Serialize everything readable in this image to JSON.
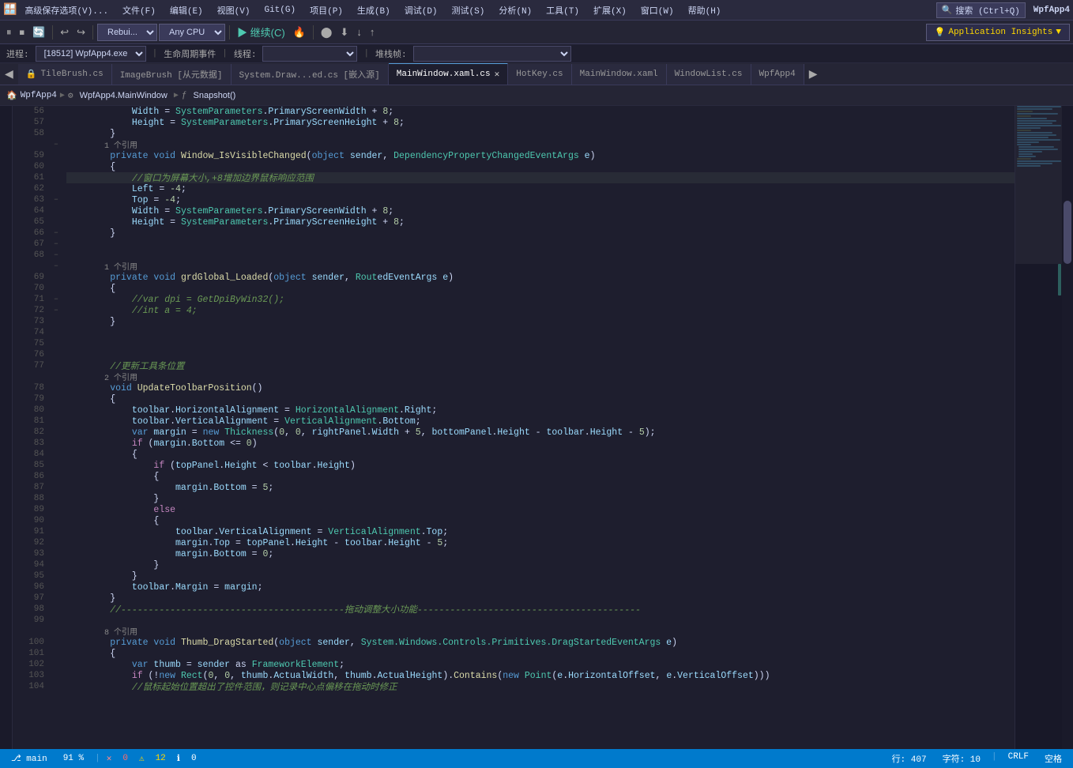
{
  "app": {
    "title": "WpfApp4",
    "window_title": "WpfApp4"
  },
  "menubar": {
    "items": [
      "高级保存选项(V)...",
      "文件(F)",
      "编辑(E)",
      "视图(V)",
      "Git(G)",
      "项目(P)",
      "生成(B)",
      "调试(D)",
      "测试(S)",
      "分析(N)",
      "工具(T)",
      "扩展(X)",
      "窗口(W)",
      "帮助(H)"
    ],
    "search_placeholder": "搜索 (Ctrl+Q)",
    "app_name": "WpfApp4"
  },
  "toolbar": {
    "debug_label": "Rebui...",
    "cpu_label": "Any CPU",
    "insights_label": "Application Insights"
  },
  "process_bar": {
    "process_label": "进程:",
    "process_value": "[18512] WpfApp4.exe",
    "lifecycle_label": "生命周期事件",
    "thread_label": "线程:",
    "stack_label": "堆栈帧:"
  },
  "tabs": [
    {
      "label": "TileBrush.cs",
      "icon": "🔒",
      "active": false
    },
    {
      "label": "ImageBrush [从元数据]",
      "icon": "🔒",
      "active": false
    },
    {
      "label": "System.Draw...ed.cs [嵌入源]",
      "active": false
    },
    {
      "label": "MainWindow.xaml.cs",
      "active": true,
      "closeable": true
    },
    {
      "label": "HotKey.cs",
      "active": false
    },
    {
      "label": "MainWindow.xaml",
      "active": false
    },
    {
      "label": "WindowList.cs",
      "active": false
    },
    {
      "label": "WpfApp4",
      "active": false
    }
  ],
  "context_bar": {
    "project": "WpfApp4",
    "class": "WpfApp4.MainWindow",
    "method": "Snapshot()"
  },
  "code": {
    "lines": [
      {
        "num": 56,
        "indent": 3,
        "content": "Width = SystemParameters.PrimaryScreenWidth + 8;",
        "type": "code"
      },
      {
        "num": 57,
        "indent": 3,
        "content": "Height = SystemParameters.PrimaryScreenHeight + 8;",
        "type": "code"
      },
      {
        "num": 58,
        "indent": 2,
        "content": "}",
        "type": "code"
      },
      {
        "num": 59,
        "indent": 1,
        "ref": "1 个引用",
        "type": "ref"
      },
      {
        "num": 59,
        "indent": 2,
        "content": "private void Window_IsVisibleChanged(object sender, DependencyPropertyChangedEventArgs e)",
        "type": "code",
        "has_collapse": true
      },
      {
        "num": 60,
        "indent": 2,
        "content": "{",
        "type": "code"
      },
      {
        "num": 61,
        "indent": 3,
        "content": "//窗口为屏幕大小,+8增加边界鼠标响应范围",
        "type": "comment"
      },
      {
        "num": 62,
        "indent": 3,
        "content": "Left = -4;",
        "type": "code"
      },
      {
        "num": 63,
        "indent": 3,
        "content": "Top = -4;",
        "type": "code"
      },
      {
        "num": 64,
        "indent": 3,
        "content": "Width = SystemParameters.PrimaryScreenWidth + 8;",
        "type": "code"
      },
      {
        "num": 65,
        "indent": 3,
        "content": "Height = SystemParameters.PrimaryScreenHeight + 8;",
        "type": "code"
      },
      {
        "num": 66,
        "indent": 2,
        "content": "}",
        "type": "code"
      },
      {
        "num": 67,
        "indent": 0,
        "content": "",
        "type": "blank"
      },
      {
        "num": 68,
        "indent": 0,
        "content": "",
        "type": "blank"
      },
      {
        "num": 69,
        "indent": 1,
        "ref": "1 个引用",
        "type": "ref"
      },
      {
        "num": 69,
        "indent": 2,
        "content": "private void grdGlobal_Loaded(object sender, RoutedEventArgs e)",
        "type": "code",
        "has_collapse": true
      },
      {
        "num": 70,
        "indent": 2,
        "content": "{",
        "type": "code"
      },
      {
        "num": 71,
        "indent": 3,
        "content": "//var dpi = GetDpiByWin32();",
        "type": "comment"
      },
      {
        "num": 72,
        "indent": 3,
        "content": "//int a = 4;",
        "type": "comment"
      },
      {
        "num": 73,
        "indent": 2,
        "content": "}",
        "type": "code"
      },
      {
        "num": 74,
        "indent": 0,
        "content": "",
        "type": "blank"
      },
      {
        "num": 75,
        "indent": 0,
        "content": "",
        "type": "blank"
      },
      {
        "num": 76,
        "indent": 0,
        "content": "",
        "type": "blank"
      },
      {
        "num": 77,
        "indent": 2,
        "content": "//更新工具条位置",
        "type": "comment"
      },
      {
        "num": 78,
        "indent": 1,
        "ref": "2 个引用",
        "type": "ref"
      },
      {
        "num": 78,
        "indent": 2,
        "content": "void UpdateToolbarPosition()",
        "type": "code",
        "has_collapse": true
      },
      {
        "num": 79,
        "indent": 2,
        "content": "{",
        "type": "code"
      },
      {
        "num": 80,
        "indent": 3,
        "content": "toolbar.HorizontalAlignment = HorizontalAlignment.Right;",
        "type": "code"
      },
      {
        "num": 81,
        "indent": 3,
        "content": "toolbar.VerticalAlignment = VerticalAlignment.Bottom;",
        "type": "code"
      },
      {
        "num": 82,
        "indent": 3,
        "content": "var margin = new Thickness(0, 0, rightPanel.Width + 5, bottomPanel.Height - toolbar.Height - 5);",
        "type": "code"
      },
      {
        "num": 83,
        "indent": 3,
        "content": "if (margin.Bottom <= 0)",
        "type": "code",
        "has_collapse": true
      },
      {
        "num": 84,
        "indent": 3,
        "content": "{",
        "type": "code"
      },
      {
        "num": 85,
        "indent": 4,
        "content": "if (topPanel.Height < toolbar.Height)",
        "type": "code",
        "has_collapse": true
      },
      {
        "num": 86,
        "indent": 4,
        "content": "{",
        "type": "code"
      },
      {
        "num": 87,
        "indent": 5,
        "content": "margin.Bottom = 5;",
        "type": "code"
      },
      {
        "num": 88,
        "indent": 4,
        "content": "}",
        "type": "code"
      },
      {
        "num": 89,
        "indent": 4,
        "content": "else",
        "type": "code",
        "has_collapse": true
      },
      {
        "num": 90,
        "indent": 4,
        "content": "{",
        "type": "code"
      },
      {
        "num": 91,
        "indent": 5,
        "content": "toolbar.VerticalAlignment = VerticalAlignment.Top;",
        "type": "code"
      },
      {
        "num": 92,
        "indent": 5,
        "content": "margin.Top = topPanel.Height - toolbar.Height - 5;",
        "type": "code"
      },
      {
        "num": 93,
        "indent": 5,
        "content": "margin.Bottom = 0;",
        "type": "code"
      },
      {
        "num": 94,
        "indent": 4,
        "content": "}",
        "type": "code"
      },
      {
        "num": 95,
        "indent": 3,
        "content": "}",
        "type": "code"
      },
      {
        "num": 96,
        "indent": 3,
        "content": "toolbar.Margin = margin;",
        "type": "code"
      },
      {
        "num": 97,
        "indent": 2,
        "content": "}",
        "type": "code"
      },
      {
        "num": 98,
        "indent": 2,
        "content": "//-----------------------------------------拖动调整大小功能-----------------------------------------",
        "type": "comment"
      },
      {
        "num": 99,
        "indent": 0,
        "content": "",
        "type": "blank"
      },
      {
        "num": 100,
        "indent": 1,
        "ref": "8 个引用",
        "type": "ref"
      },
      {
        "num": 100,
        "indent": 2,
        "content": "private void Thumb_DragStarted(object sender, System.Windows.Controls.Primitives.DragStartedEventArgs e)",
        "type": "code",
        "has_collapse": true
      },
      {
        "num": 101,
        "indent": 2,
        "content": "{",
        "type": "code"
      },
      {
        "num": 102,
        "indent": 3,
        "content": "var thumb = sender as FrameworkElement;",
        "type": "code"
      },
      {
        "num": 103,
        "indent": 3,
        "content": "if (!new Rect(0, 0, thumb.ActualWidth, thumb.ActualHeight).Contains(new Point(e.HorizontalOffset, e.VerticalOffset)))",
        "type": "code",
        "has_collapse": true
      },
      {
        "num": 104,
        "indent": 3,
        "content": "//鼠标起始位置超出了控件范围，则记录中心点偏移在拖动时修正",
        "type": "comment"
      }
    ]
  },
  "status_bar": {
    "zoom": "91 %",
    "errors": "0",
    "warnings": "12",
    "messages": "0",
    "line": "行: 407",
    "col": "字符: 10",
    "encoding": "CRLF",
    "format": "空格"
  }
}
